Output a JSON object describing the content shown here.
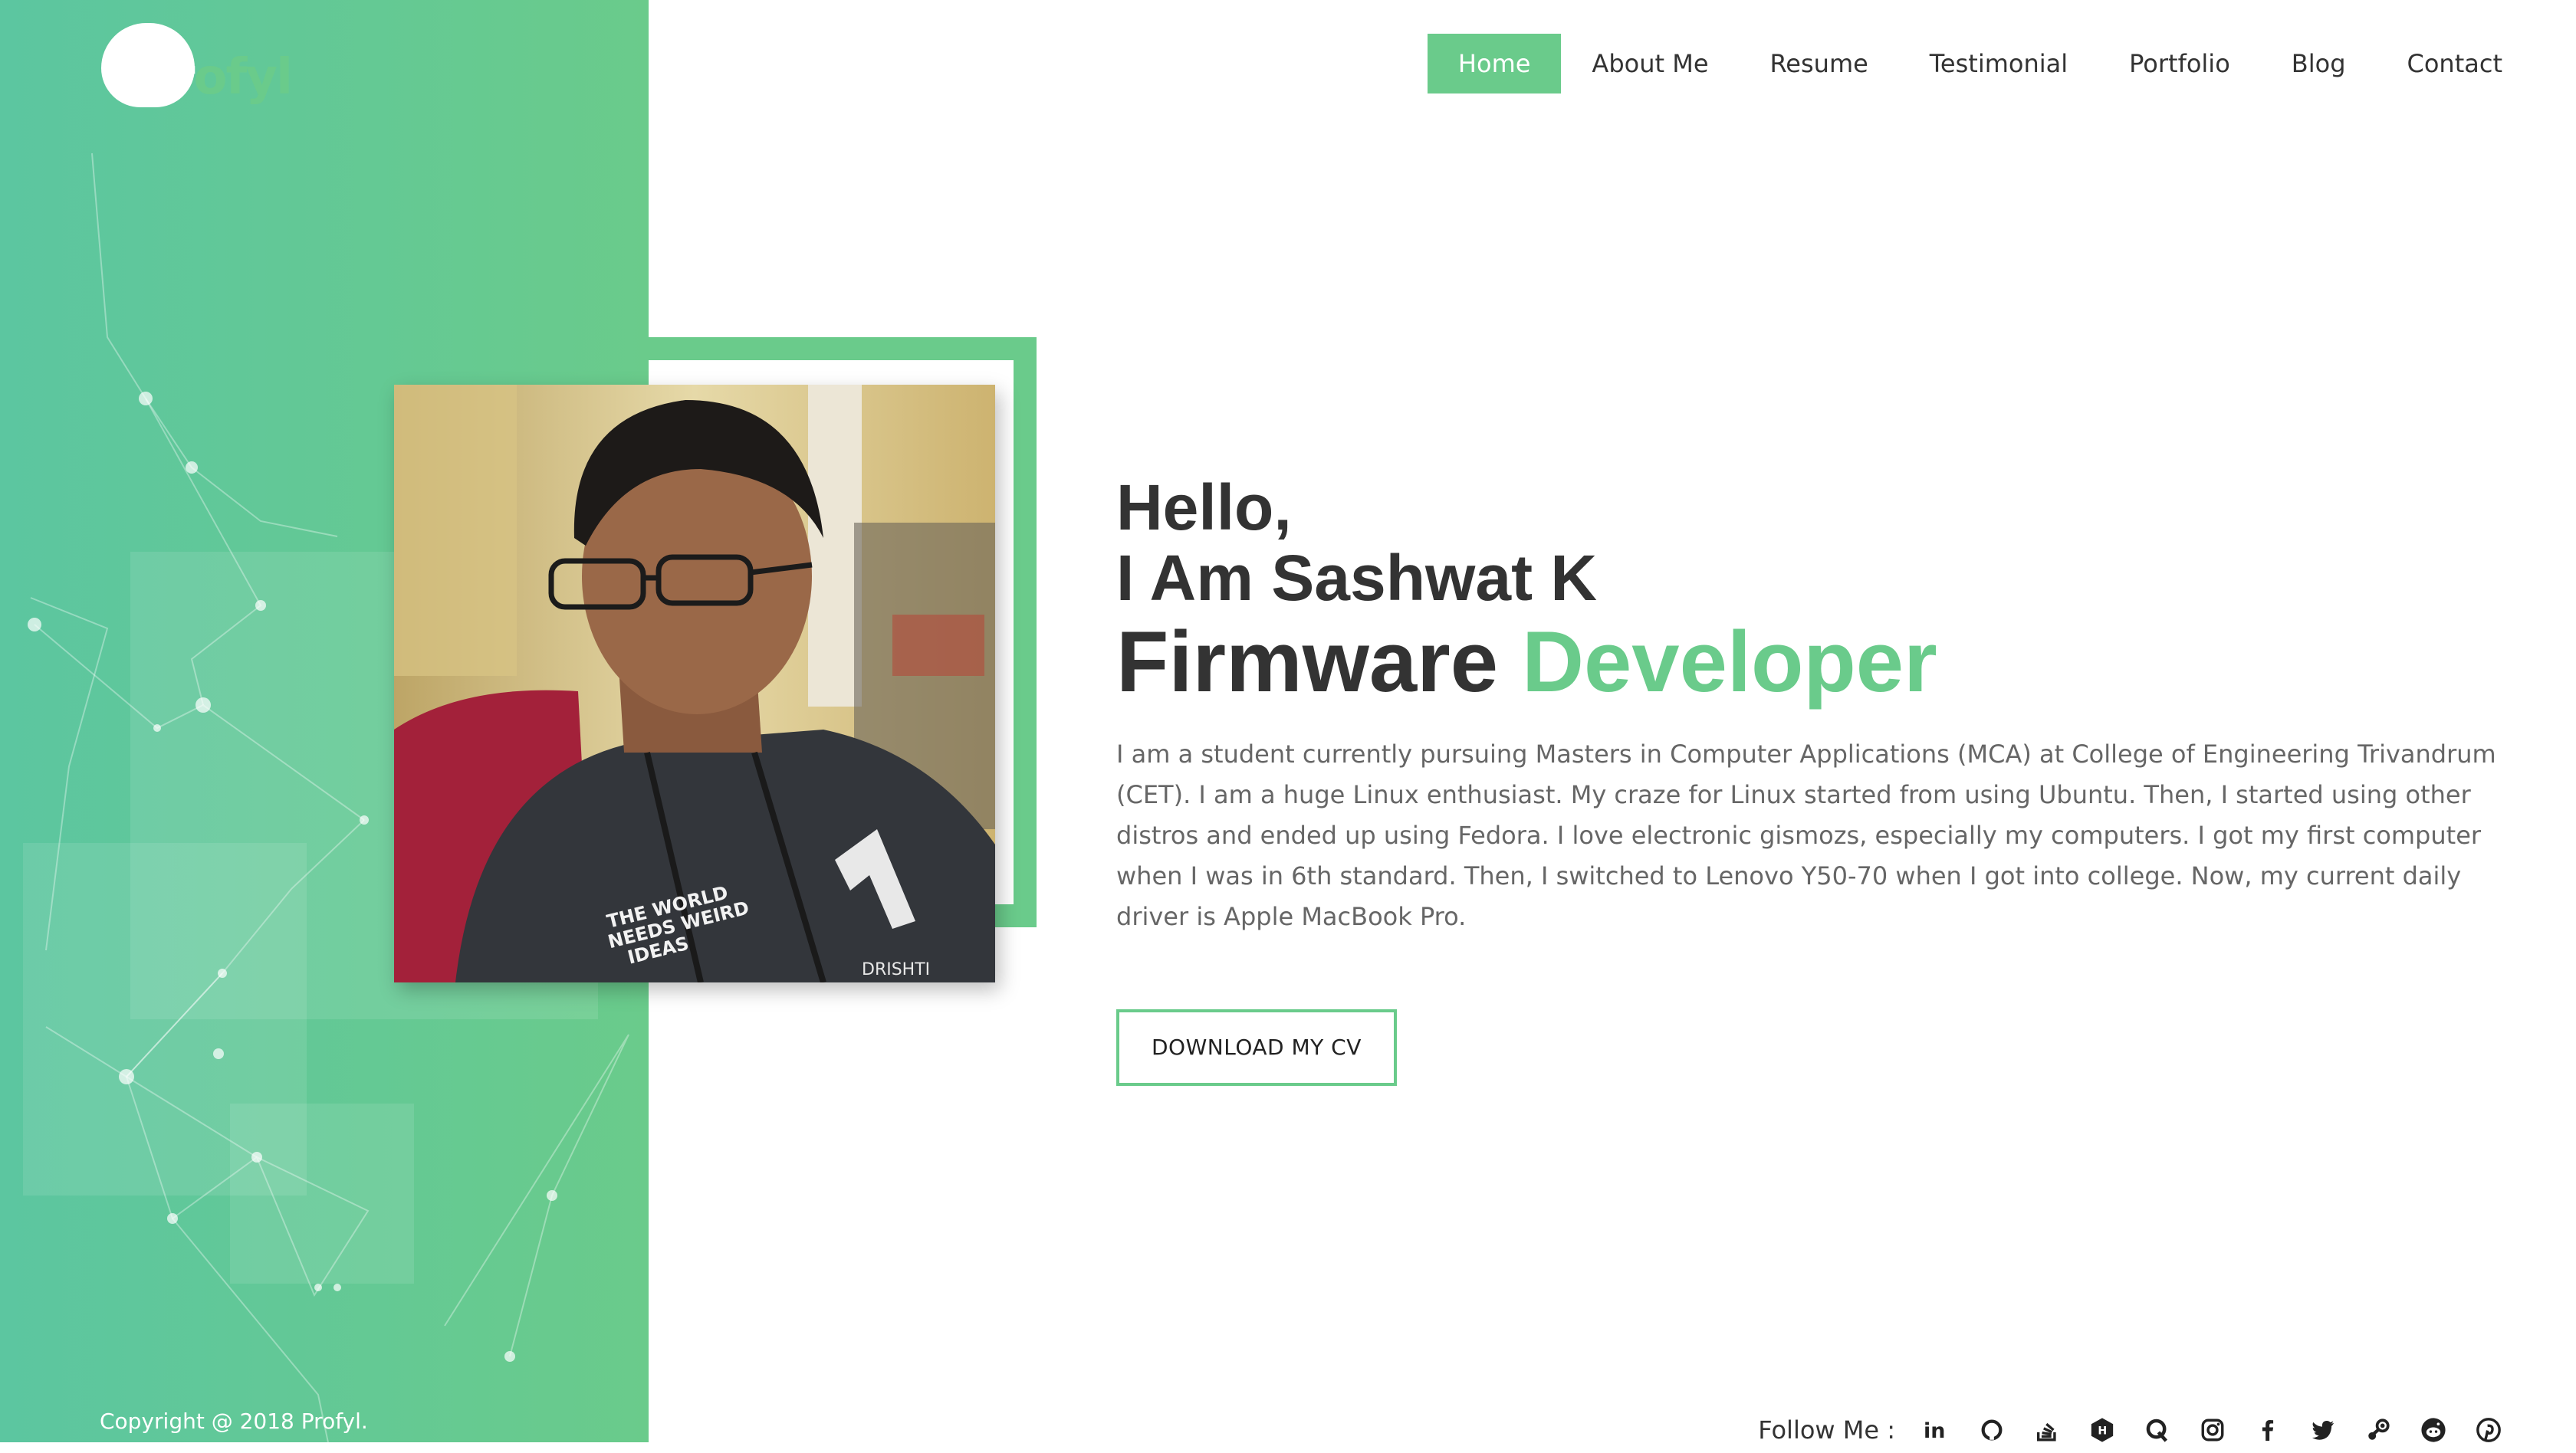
{
  "brand": {
    "name": "Profyl",
    "copyright": "Copyright @ 2018 Profyl."
  },
  "nav": {
    "items": [
      {
        "label": "Home",
        "active": true
      },
      {
        "label": "About Me"
      },
      {
        "label": "Resume"
      },
      {
        "label": "Testimonial"
      },
      {
        "label": "Portfolio"
      },
      {
        "label": "Blog"
      },
      {
        "label": "Contact"
      }
    ]
  },
  "hero": {
    "greeting_line1": "Hello,",
    "greeting_line2": "I Am Sashwat K",
    "role_word1": "Firmware",
    "role_word2": "Developer",
    "bio": "I am a student currently pursuing Masters in Computer Applications (MCA) at College of Engineering Trivandrum (CET). I am a huge Linux enthusiast. My craze for Linux started from using Ubuntu. Then, I started using other distros and ended up using Fedora. I love electronic gismozs, especially my computers. I got my first computer when I was in 6th standard. Then, I switched to Lenovo Y50-70 when I got into college. Now, my current daily driver is Apple MacBook Pro.",
    "cv_button": "DOWNLOAD MY CV"
  },
  "photo": {
    "shirt_text": [
      "THE WORLD",
      "NEEDS WEIRD",
      "IDEAS"
    ],
    "logo_text": "DRISHTI"
  },
  "follow": {
    "label": "Follow Me :",
    "icons": [
      "linkedin-icon",
      "github-icon",
      "stackoverflow-icon",
      "hackerrank-icon",
      "quora-icon",
      "instagram-icon",
      "facebook-icon",
      "twitter-icon",
      "steam-icon",
      "reddit-icon",
      "pinterest-icon"
    ]
  },
  "colors": {
    "accent": "#6acb8b",
    "panel": "#5cc6a0",
    "text": "#333333",
    "muted": "#666666"
  }
}
